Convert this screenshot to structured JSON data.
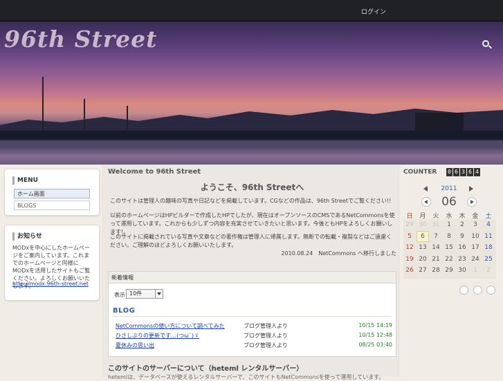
{
  "topbar": {
    "link": "ログイン"
  },
  "header": {
    "site_title": "96th Street",
    "zoom_label": "拡大"
  },
  "left": {
    "menu": {
      "title": "MENU",
      "items": [
        {
          "label": "ホーム画面"
        },
        {
          "label": "BLOGS"
        }
      ]
    },
    "info": {
      "title": "お知らせ",
      "text": "MODxを中心にしたホームページをご案内しています。これまでのホームページと同様にMODxを活用したサイトもご覧ください。よろしくお願いいたします。",
      "link": "http://modx.96th-street.net"
    }
  },
  "main": {
    "head": "Welcome to 96th Street",
    "title": "ようこそ、96th Streetへ",
    "paragraphs": [
      "このサイトは管理人の趣味の写真や日記などを掲載しています。CGなどの作品は、96th Streetでご覧ください!!",
      "以前のホームページはHPビルダーで作成したHPでしたが、現在はオープンソースのCMSであるNetCommonsを使って運用しています。これからも少しずつ内容を充実させていきたいと思います。今後ともHPをよろしくお願いします!。",
      "このサイトに掲載されている写真や文章などの著作権は管理人に帰属します。無断での転載・複製などはご遠慮ください。ご理解のほどよろしくお願いいたします。"
    ],
    "signature": "2010.08.24　NetCommons へ移行しました",
    "blog": {
      "header": "新着情報",
      "select_label": "表示",
      "select_value": "10件",
      "title": "BLOG",
      "rows": [
        {
          "title": "NetCommonsの使い方について調べてみた",
          "author": "ブログ管理人より",
          "date": "10/15 14:19"
        },
        {
          "title": "ひさしぶりの更新です…(つω`)ゞ",
          "author": "ブログ管理人より",
          "date": "10/15 12:48"
        },
        {
          "title": "夏休みの思い出",
          "author": "ブログ管理人より",
          "date": "08/25 03:40"
        }
      ]
    },
    "bottom_head": "このサイトのサーバーについて（heteml レンタルサーバー）",
    "bottom_text": "hetemlは、データベースが使えるレンタルサーバーで、このサイトもNetCommonsを使って運用しています。"
  },
  "right": {
    "counter_label": "COUNTER",
    "counter_digits": [
      "0",
      "6",
      "3",
      "6",
      "4"
    ],
    "calendar": {
      "year": "2011",
      "month": "06",
      "weekdays": [
        "日",
        "月",
        "火",
        "水",
        "木",
        "金",
        "土"
      ],
      "weeks": [
        [
          "29",
          "30",
          "31",
          "1",
          "2",
          "3",
          "4"
        ],
        [
          "5",
          "6",
          "7",
          "8",
          "9",
          "10",
          "11"
        ],
        [
          "12",
          "13",
          "14",
          "15",
          "16",
          "17",
          "18"
        ],
        [
          "19",
          "20",
          "21",
          "22",
          "23",
          "24",
          "25"
        ],
        [
          "26",
          "27",
          "28",
          "29",
          "30",
          "1",
          "2"
        ]
      ],
      "today": "6"
    }
  }
}
